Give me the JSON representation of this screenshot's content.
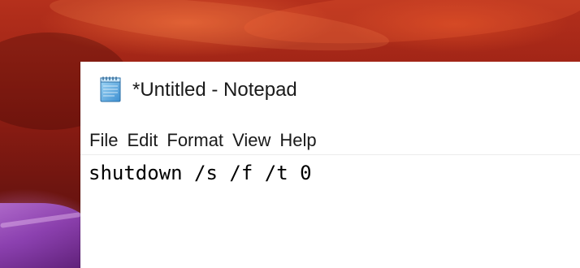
{
  "window": {
    "title": "*Untitled - Notepad",
    "icon": "notepad-icon"
  },
  "menu": {
    "items": [
      {
        "label": "File"
      },
      {
        "label": "Edit"
      },
      {
        "label": "Format"
      },
      {
        "label": "View"
      },
      {
        "label": "Help"
      }
    ]
  },
  "editor": {
    "content": "shutdown /s /f /t 0"
  },
  "colors": {
    "window_bg": "#ffffff",
    "text": "#1a1a1a",
    "desktop_accent": "#a32617",
    "desktop_purple": "#8a3fb0"
  }
}
